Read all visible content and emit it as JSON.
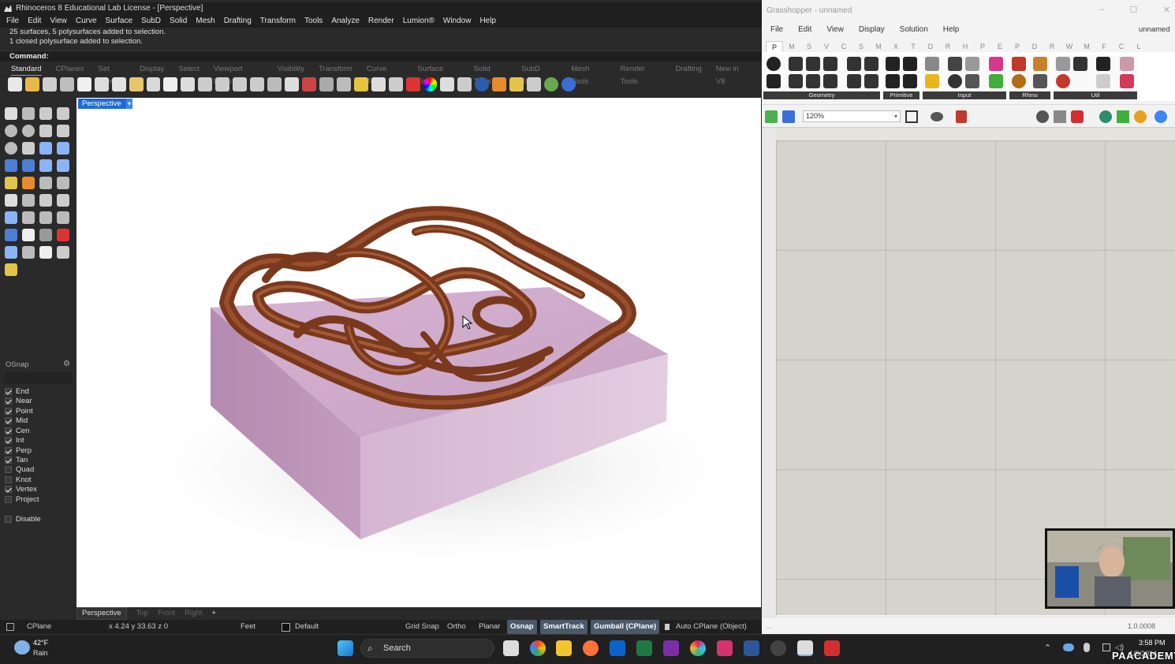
{
  "rhino": {
    "title": "Rhinoceros 8 Educational Lab License - [Perspective]",
    "menu": [
      "File",
      "Edit",
      "View",
      "Curve",
      "Surface",
      "SubD",
      "Solid",
      "Mesh",
      "Drafting",
      "Transform",
      "Tools",
      "Analyze",
      "Render",
      "Lumion®",
      "Window",
      "Help"
    ],
    "history": [
      "25 surfaces, 5 polysurfaces added to selection.",
      "1 closed polysurface added to selection."
    ],
    "command_label": "Command:",
    "toolbar_tabs": [
      "Standard",
      "CPlanes",
      "Set View",
      "Display",
      "Select",
      "Viewport Layout",
      "Visibility",
      "Transform",
      "Curve Tools",
      "Surface Tools",
      "Solid Tools",
      "SubD Tools",
      "Mesh Tools",
      "Render Tools",
      "Drafting",
      "New in V8"
    ],
    "active_tab": "Standard",
    "viewport_label": "Perspective",
    "viewport_label_arrow": "▾",
    "osnap": {
      "title": "OSnap",
      "items": [
        {
          "label": "End",
          "checked": true
        },
        {
          "label": "Near",
          "checked": true
        },
        {
          "label": "Point",
          "checked": true
        },
        {
          "label": "Mid",
          "checked": true
        },
        {
          "label": "Cen",
          "checked": true
        },
        {
          "label": "Int",
          "checked": true
        },
        {
          "label": "Perp",
          "checked": true
        },
        {
          "label": "Tan",
          "checked": true
        },
        {
          "label": "Quad",
          "checked": false
        },
        {
          "label": "Knot",
          "checked": false
        },
        {
          "label": "Vertex",
          "checked": true
        },
        {
          "label": "Project",
          "checked": false
        }
      ],
      "disable": {
        "label": "Disable",
        "checked": false
      }
    },
    "viewport_tabs": [
      "Perspective",
      "Top",
      "Front",
      "Right"
    ],
    "add_viewport": "+",
    "status": {
      "cplane": "CPlane",
      "coords": "x 4.24  y 33.63  z 0",
      "units": "Feet",
      "layer": "Default",
      "grid_snap": "Grid Snap",
      "ortho": "Ortho",
      "planar": "Planar",
      "osnap": "Osnap",
      "smarttrack": "SmartTrack",
      "gumball": "Gumball (CPlane)",
      "auto_cplane": "Auto CPlane (Object)"
    },
    "colors": {
      "terrain": "#7c3a1f",
      "base": "#c6a2c2",
      "viewport": "#ffffff",
      "accent": "#1e6bd6"
    }
  },
  "grasshopper": {
    "title": "Grasshopper - unnamed",
    "menu": [
      "File",
      "Edit",
      "View",
      "Display",
      "Solution",
      "Help"
    ],
    "doc_name": "unnamed",
    "tabs": [
      "P",
      "M",
      "S",
      "V",
      "C",
      "S",
      "M",
      "X",
      "T",
      "D",
      "R",
      "H",
      "P",
      "E",
      "P",
      "D",
      "R",
      "W",
      "M",
      "F",
      "C",
      "L"
    ],
    "active_tab": "P",
    "groups": [
      "Geometry",
      "Primitive",
      "Input",
      "Rhino",
      "Util"
    ],
    "zoom": "120%",
    "version": "1.0.0008"
  },
  "taskbar": {
    "weather_temp": "42°F",
    "weather_cond": "Rain",
    "search": "Search",
    "time": "3:58 PM",
    "date": "1/5/2024",
    "watermark": "PAACADEMY"
  }
}
